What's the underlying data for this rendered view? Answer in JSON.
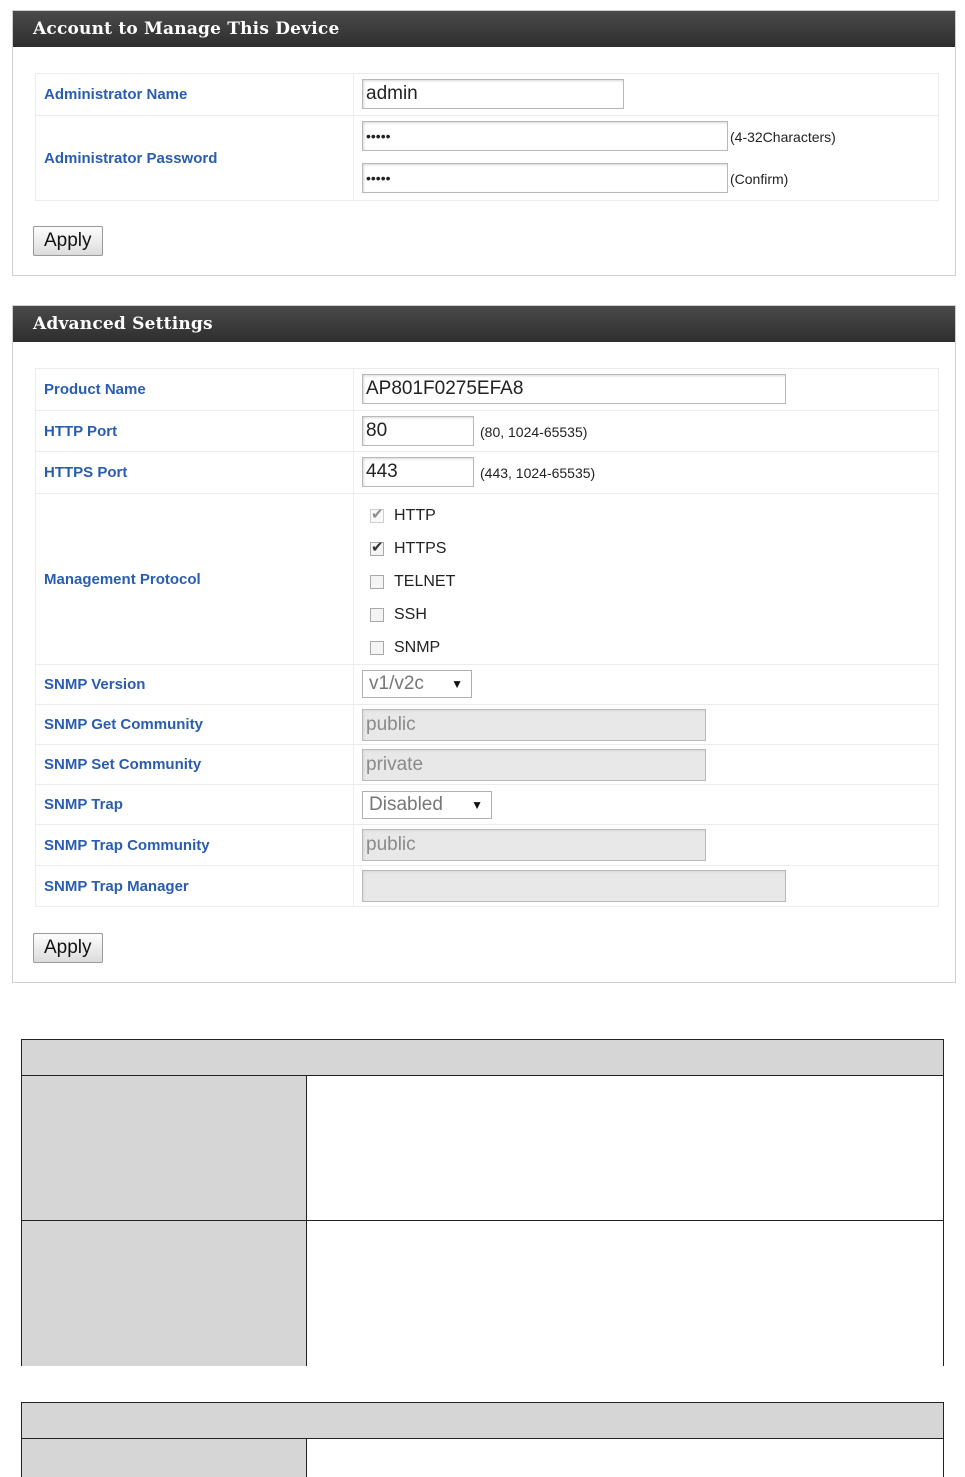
{
  "account_panel": {
    "title": "Account to Manage This Device",
    "admin_name_label": "Administrator Name",
    "admin_name_value": "admin",
    "admin_password_label": "Administrator Password",
    "password_value": "•••••",
    "password_hint": "(4-32Characters)",
    "confirm_value": "•••••",
    "confirm_hint": "(Confirm)",
    "apply_label": "Apply"
  },
  "advanced_panel": {
    "title": "Advanced Settings",
    "product_name_label": "Product Name",
    "product_name_value": "AP801F0275EFA8",
    "http_port_label": "HTTP Port",
    "http_port_value": "80",
    "http_port_hint": "(80, 1024-65535)",
    "https_port_label": "HTTPS Port",
    "https_port_value": "443",
    "https_port_hint": "(443, 1024-65535)",
    "management_protocol_label": "Management Protocol",
    "protocols": [
      {
        "name": "HTTP",
        "checked": true,
        "disabled": true
      },
      {
        "name": "HTTPS",
        "checked": true,
        "disabled": false
      },
      {
        "name": "TELNET",
        "checked": false,
        "disabled": false
      },
      {
        "name": "SSH",
        "checked": false,
        "disabled": false
      },
      {
        "name": "SNMP",
        "checked": false,
        "disabled": false
      }
    ],
    "snmp_version_label": "SNMP Version",
    "snmp_version_value": "v1/v2c",
    "snmp_get_label": "SNMP Get Community",
    "snmp_get_value": "public",
    "snmp_set_label": "SNMP Set Community",
    "snmp_set_value": "private",
    "snmp_trap_label": "SNMP Trap",
    "snmp_trap_value": "Disabled",
    "snmp_trap_community_label": "SNMP Trap Community",
    "snmp_trap_community_value": "public",
    "snmp_trap_manager_label": "SNMP Trap Manager",
    "snmp_trap_manager_value": "",
    "apply_label": "Apply"
  },
  "colors": {
    "label_blue": "#2a5db0",
    "header_dark": "#3a3a3a",
    "table_gray": "#d6d6d6"
  }
}
